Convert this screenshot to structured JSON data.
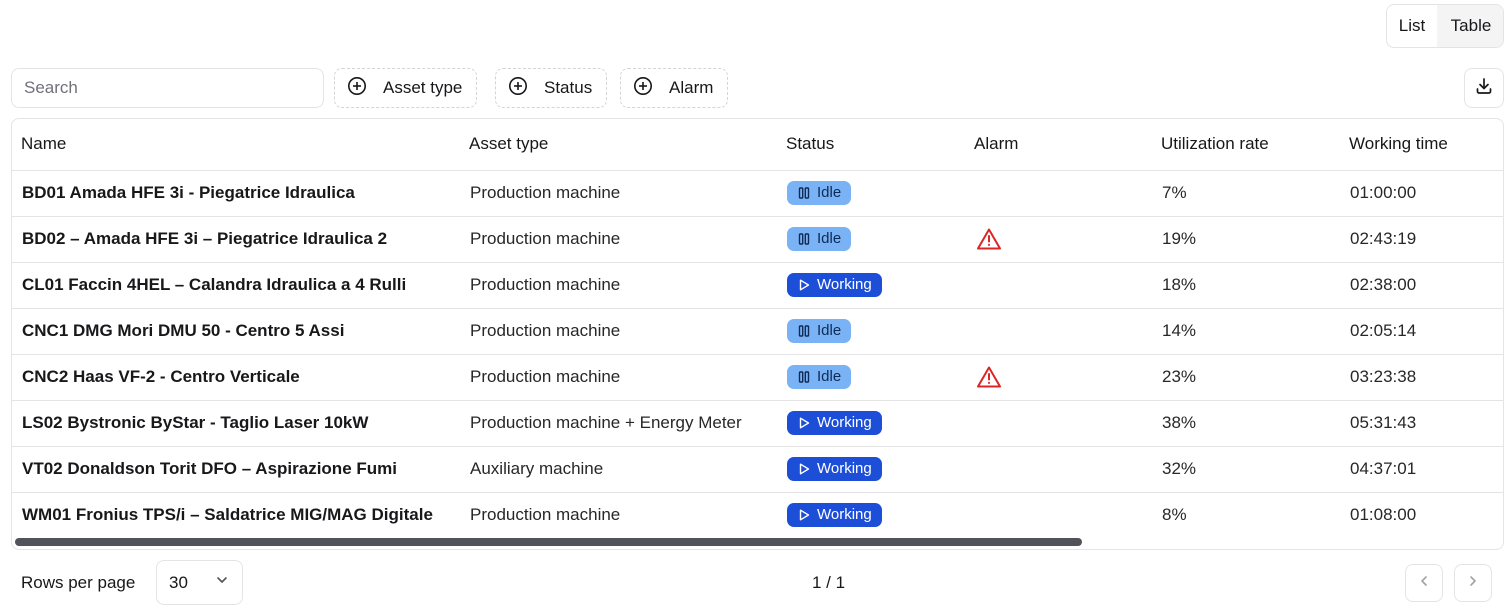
{
  "view_toggle": {
    "list": "List",
    "table": "Table",
    "active": "Table"
  },
  "toolbar": {
    "search_placeholder": "Search",
    "filters": [
      {
        "label": "Asset type",
        "icon": "plus-circle-icon"
      },
      {
        "label": "Status",
        "icon": "plus-circle-icon"
      },
      {
        "label": "Alarm",
        "icon": "plus-circle-icon"
      }
    ],
    "download_icon": "download-icon"
  },
  "table": {
    "columns": [
      "Name",
      "Asset type",
      "Status",
      "Alarm",
      "Utilization rate",
      "Working time"
    ],
    "rows": [
      {
        "name": "BD01 Amada HFE 3i - Piegatrice Idraulica",
        "asset_type": "Production machine",
        "status": "Idle",
        "alarm": false,
        "utilization": "7%",
        "working_time": "01:00:00"
      },
      {
        "name": "BD02 – Amada HFE 3i – Piegatrice Idraulica 2",
        "asset_type": "Production machine",
        "status": "Idle",
        "alarm": true,
        "utilization": "19%",
        "working_time": "02:43:19"
      },
      {
        "name": "CL01 Faccin 4HEL – Calandra Idraulica a 4 Rulli",
        "asset_type": "Production machine",
        "status": "Working",
        "alarm": false,
        "utilization": "18%",
        "working_time": "02:38:00"
      },
      {
        "name": "CNC1 DMG Mori DMU 50 - Centro 5 Assi",
        "asset_type": "Production machine",
        "status": "Idle",
        "alarm": false,
        "utilization": "14%",
        "working_time": "02:05:14"
      },
      {
        "name": "CNC2 Haas VF-2 - Centro Verticale",
        "asset_type": "Production machine",
        "status": "Idle",
        "alarm": true,
        "utilization": "23%",
        "working_time": "03:23:38"
      },
      {
        "name": "LS02 Bystronic ByStar - Taglio Laser 10kW",
        "asset_type": "Production machine + Energy Meter",
        "status": "Working",
        "alarm": false,
        "utilization": "38%",
        "working_time": "05:31:43"
      },
      {
        "name": "VT02 Donaldson Torit DFO – Aspirazione Fumi",
        "asset_type": "Auxiliary machine",
        "status": "Working",
        "alarm": false,
        "utilization": "32%",
        "working_time": "04:37:01"
      },
      {
        "name": "WM01 Fronius TPS/i – Saldatrice MIG/MAG Digitale",
        "asset_type": "Production machine",
        "status": "Working",
        "alarm": false,
        "utilization": "8%",
        "working_time": "01:08:00"
      }
    ]
  },
  "status_colors": {
    "Idle": "#7ab3f5",
    "Working": "#1d4ed8",
    "alarm": "#dc2626"
  },
  "footer": {
    "rows_per_page_label": "Rows per page",
    "rows_per_page_value": "30",
    "page_info": "1 / 1"
  }
}
